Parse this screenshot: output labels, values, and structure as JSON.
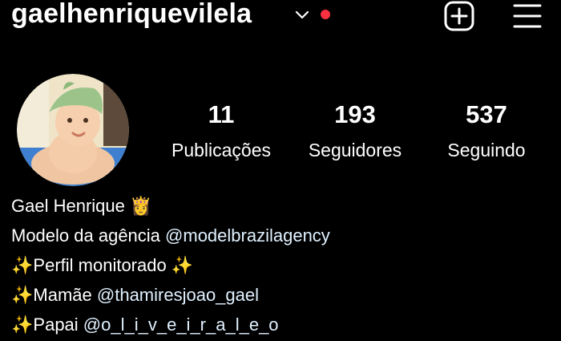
{
  "header": {
    "username": "gaelhenriquevilela",
    "chevron_icon": "chevron-down-icon",
    "notification_dot_color": "#ff3040",
    "create_icon": "plus-square-icon",
    "menu_icon": "hamburger-menu-icon"
  },
  "profile": {
    "avatar_icon": "baby-with-green-hat-photo"
  },
  "stats": [
    {
      "value": "11",
      "label": "Publicações"
    },
    {
      "value": "193",
      "label": "Seguidores"
    },
    {
      "value": "537",
      "label": "Seguindo"
    }
  ],
  "bio": {
    "name": "Gael Henrique",
    "name_emoji": "👸",
    "line2_text": "Modelo da agência ",
    "line2_mention": "@modelbrazilagency",
    "sparkle": "✨",
    "line3_text": "Perfil monitorado ",
    "line4_text": "Mamãe ",
    "line4_mention": "@thamiresjoao_gael",
    "line5_text": "Papai ",
    "line5_mention": "@o_l_i_v_e_i_r_a_l_e_o"
  },
  "colors": {
    "background": "#000000",
    "text": "#ffffff",
    "sparkle": "#ffd21f"
  }
}
